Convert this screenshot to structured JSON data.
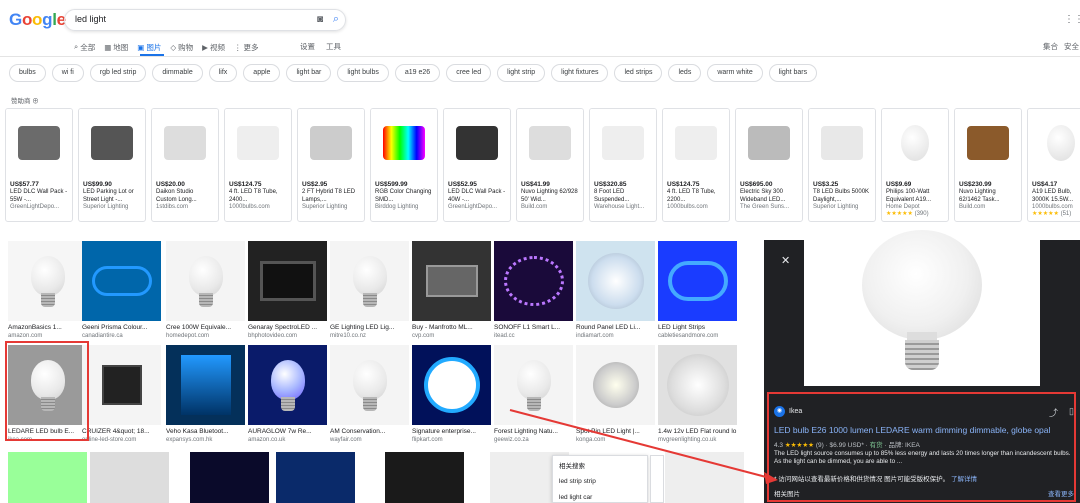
{
  "header": {
    "logo": "Google",
    "query": "led light",
    "tabs": [
      {
        "label": "全部",
        "icon": "search-icon"
      },
      {
        "label": "地图",
        "icon": "map-icon"
      },
      {
        "label": "图片",
        "icon": "image-icon",
        "active": true
      },
      {
        "label": "购物",
        "icon": "tag-icon"
      },
      {
        "label": "视频",
        "icon": "video-icon"
      },
      {
        "label": "更多",
        "icon": "more-icon"
      }
    ],
    "settings": "设置",
    "tools": "工具",
    "right1": "集合",
    "right2": "安全"
  },
  "chips": [
    "bulbs",
    "wi fi",
    "rgb led strip",
    "dimmable",
    "lifx",
    "apple",
    "light bar",
    "light bulbs",
    "a19 e26",
    "cree led",
    "light strip",
    "light fixtures",
    "led strips",
    "leds",
    "warm white",
    "light bars"
  ],
  "sponsored_label": "赞助商 ⊕",
  "products": [
    {
      "price": "US$57.77",
      "name": "LED DLC Wall Pack - 55W -...",
      "store": "GreenLightDepo..."
    },
    {
      "price": "US$99.90",
      "name": "LED Parking Lot or Street Light -...",
      "store": "Superior Lighting"
    },
    {
      "price": "US$20.00",
      "name": "Daikon Studio Custom Long...",
      "store": "1stdibs.com"
    },
    {
      "price": "US$124.75",
      "name": "4 ft. LED T8 Tube, 2400...",
      "store": "1000bulbs.com"
    },
    {
      "price": "US$2.95",
      "name": "2 FT Hybrid T8 LED Lamps,...",
      "store": "Superior Lighting"
    },
    {
      "price": "US$599.99",
      "name": "RGB Color Changing SMD...",
      "store": "Birddog Lighting"
    },
    {
      "price": "US$52.95",
      "name": "LED DLC Wall Pack - 40W -...",
      "store": "GreenLightDepo..."
    },
    {
      "price": "US$41.99",
      "name": "Nuvo Lighting 62/928 50' Wid...",
      "store": "Build.com"
    },
    {
      "price": "US$320.85",
      "name": "8 Foot LED Suspended...",
      "store": "Warehouse Light..."
    },
    {
      "price": "US$124.75",
      "name": "4 ft. LED T8 Tube, 2200...",
      "store": "1000bulbs.com"
    },
    {
      "price": "US$695.00",
      "name": "Electric Sky 300 Wideband LED...",
      "store": "The Green Suns..."
    },
    {
      "price": "US$3.25",
      "name": "T8 LED Bulbs 5000K Daylight,...",
      "store": "Superior Lighting"
    },
    {
      "price": "US$9.69",
      "name": "Philips 100-Watt Equivalent A19...",
      "store": "Home Depot",
      "rating": "★★★★★",
      "count": "(390)"
    },
    {
      "price": "US$230.99",
      "name": "Nuvo Lighting 62/1462 Task...",
      "store": "Build.com"
    },
    {
      "price": "US$4.17",
      "name": "A19 LED Bulb, 3000K 15.5W...",
      "store": "1000bulbs.com",
      "rating": "★★★★★",
      "count": "(51)"
    }
  ],
  "grid": [
    {
      "caption": "AmazonBasics 1...",
      "source": "amazon.com"
    },
    {
      "caption": "Geeni Prisma Colour...",
      "source": "canadiantire.ca"
    },
    {
      "caption": "Cree 100W Equivale...",
      "source": "homedepot.com"
    },
    {
      "caption": "Genaray SpectroLED ...",
      "source": "bhphotovideo.com"
    },
    {
      "caption": "GE Lighting LED Lig...",
      "source": "mitre10.co.nz"
    },
    {
      "caption": "Buy - Manfrotto ML...",
      "source": "cvp.com"
    },
    {
      "caption": "SONOFF L1 Smart L...",
      "source": "itead.cc"
    },
    {
      "caption": "Round Panel LED Li...",
      "source": "indiamart.com"
    },
    {
      "caption": "LED Light Strips",
      "source": "cabletiesandmore.com"
    },
    {
      "caption": "LEDARE LED bulb E...",
      "source": "ikea.com"
    },
    {
      "caption": "CRUIZER 4&quot; 18...",
      "source": "online-led-store.com"
    },
    {
      "caption": "Veho Kasa Bluetoot...",
      "source": "expansys.com.hk"
    },
    {
      "caption": "AURAGLOW 7w Re...",
      "source": "amazon.co.uk"
    },
    {
      "caption": "AM Conservation...",
      "source": "wayfair.com"
    },
    {
      "caption": "Signature enterprise...",
      "source": "flipkart.com"
    },
    {
      "caption": "Forest Lighting Natu...",
      "source": "geewiz.co.za"
    },
    {
      "caption": "Spot Pin LED Light |...",
      "source": "konga.com"
    },
    {
      "caption": "1.4w 12v LED Flat round lo...",
      "source": "mvgreenlighting.co.uk"
    }
  ],
  "panel": {
    "brand": "Ikea",
    "title": "LED bulb E26 1000 lumen LEDARE warm dimming dimmable, globe opal",
    "rating": "4.3",
    "stars": "★★★★★",
    "count": "(9)",
    "price": "$6.99 USD*",
    "stock": "有货",
    "brand_label": "品牌: IKEA",
    "description": "The LED light source consumes up to 85% less energy and lasts 20 times longer than incandescent bulbs. As the light can be dimmed, you are able to ...",
    "visit_note": "* 访问网站以查看最新价格和供货情况 图片可能受版权保护。",
    "learn_more": "了解详情",
    "related": "相关图片",
    "view_more": "查看更多"
  },
  "related_popup": {
    "title": "相关搜索",
    "items": [
      "led strip strip",
      "led light car"
    ]
  },
  "colors": {
    "accent": "#1a73e8",
    "highlight": "#e53935",
    "panel_bg": "#202124"
  }
}
